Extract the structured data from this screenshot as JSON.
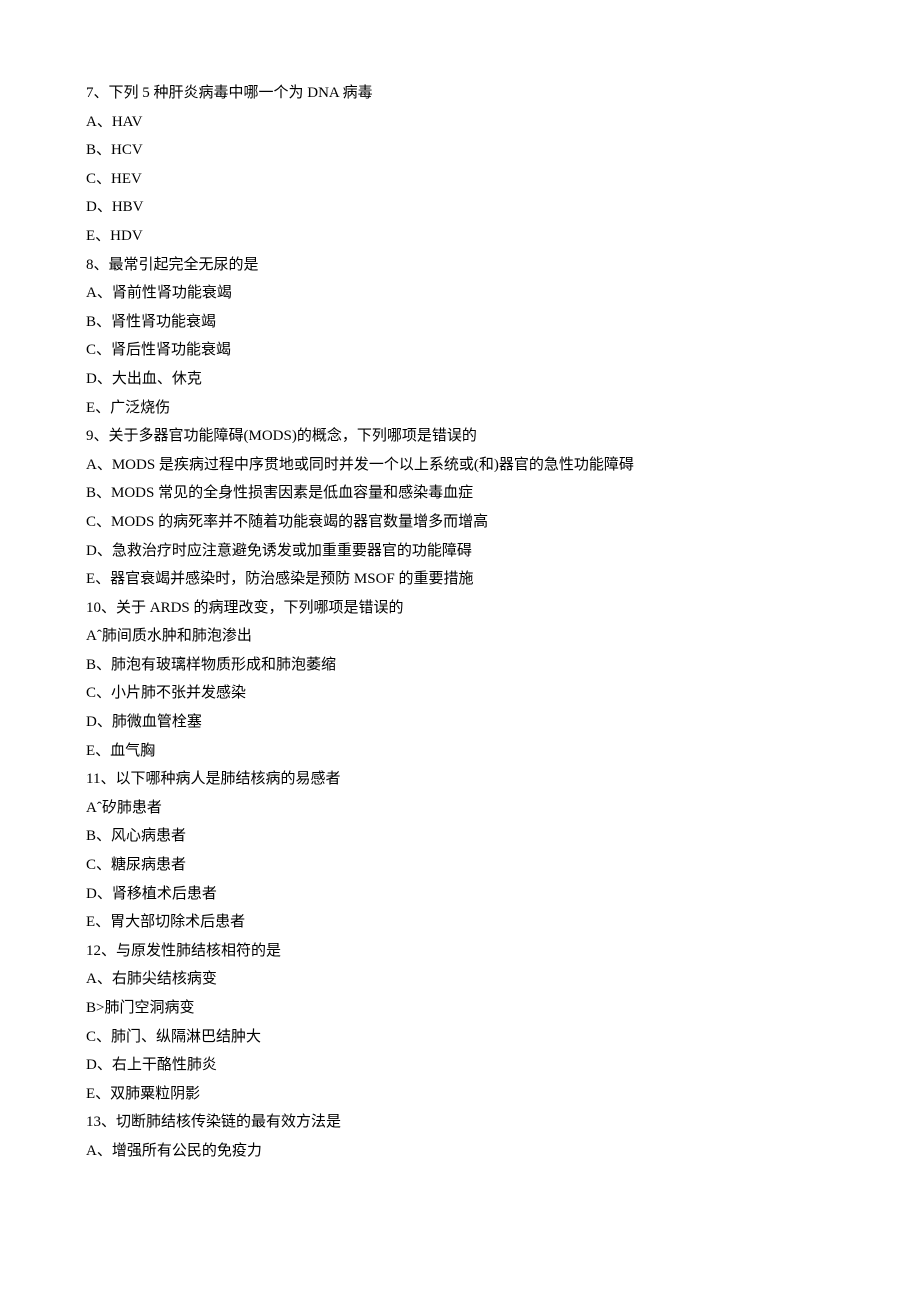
{
  "questions": [
    {
      "stem": "7、下列 5 种肝炎病毒中哪一个为 DNA 病毒",
      "options": [
        "A、HAV",
        "B、HCV",
        "C、HEV",
        "D、HBV",
        "E、HDV"
      ]
    },
    {
      "stem": "8、最常引起完全无尿的是",
      "options": [
        "A、肾前性肾功能衰竭",
        "B、肾性肾功能衰竭",
        "C、肾后性肾功能衰竭",
        "D、大出血、休克",
        "E、广泛烧伤"
      ]
    },
    {
      "stem": "9、关于多器官功能障碍(MODS)的概念，下列哪项是错误的",
      "options": [
        "A、MODS 是疾病过程中序贯地或同时并发一个以上系统或(和)器官的急性功能障碍",
        "B、MODS 常见的全身性损害因素是低血容量和感染毒血症",
        "C、MODS 的病死率并不随着功能衰竭的器官数量增多而增高",
        "D、急救治疗时应注意避免诱发或加重重要器官的功能障碍",
        "E、器官衰竭并感染时，防治感染是预防 MSOF 的重要措施"
      ]
    },
    {
      "stem": "10、关于 ARDS 的病理改变，下列哪项是错误的",
      "options": [
        "Aˆ肺间质水肿和肺泡渗出",
        "B、肺泡有玻璃样物质形成和肺泡萎缩",
        "C、小片肺不张并发感染",
        "D、肺微血管栓塞",
        "E、血气胸"
      ]
    },
    {
      "stem": "11、以下哪种病人是肺结核病的易感者",
      "options": [
        "Aˆ矽肺患者",
        "B、风心病患者",
        "C、糖尿病患者",
        "D、肾移植术后患者",
        "E、胃大部切除术后患者"
      ]
    },
    {
      "stem": "12、与原发性肺结核相符的是",
      "options": [
        "A、右肺尖结核病变",
        "B>肺门空洞病变",
        "C、肺门、纵隔淋巴结肿大",
        "D、右上干酪性肺炎",
        "E、双肺粟粒阴影"
      ]
    },
    {
      "stem": "13、切断肺结核传染链的最有效方法是",
      "options": [
        "A、增强所有公民的免疫力"
      ]
    }
  ]
}
